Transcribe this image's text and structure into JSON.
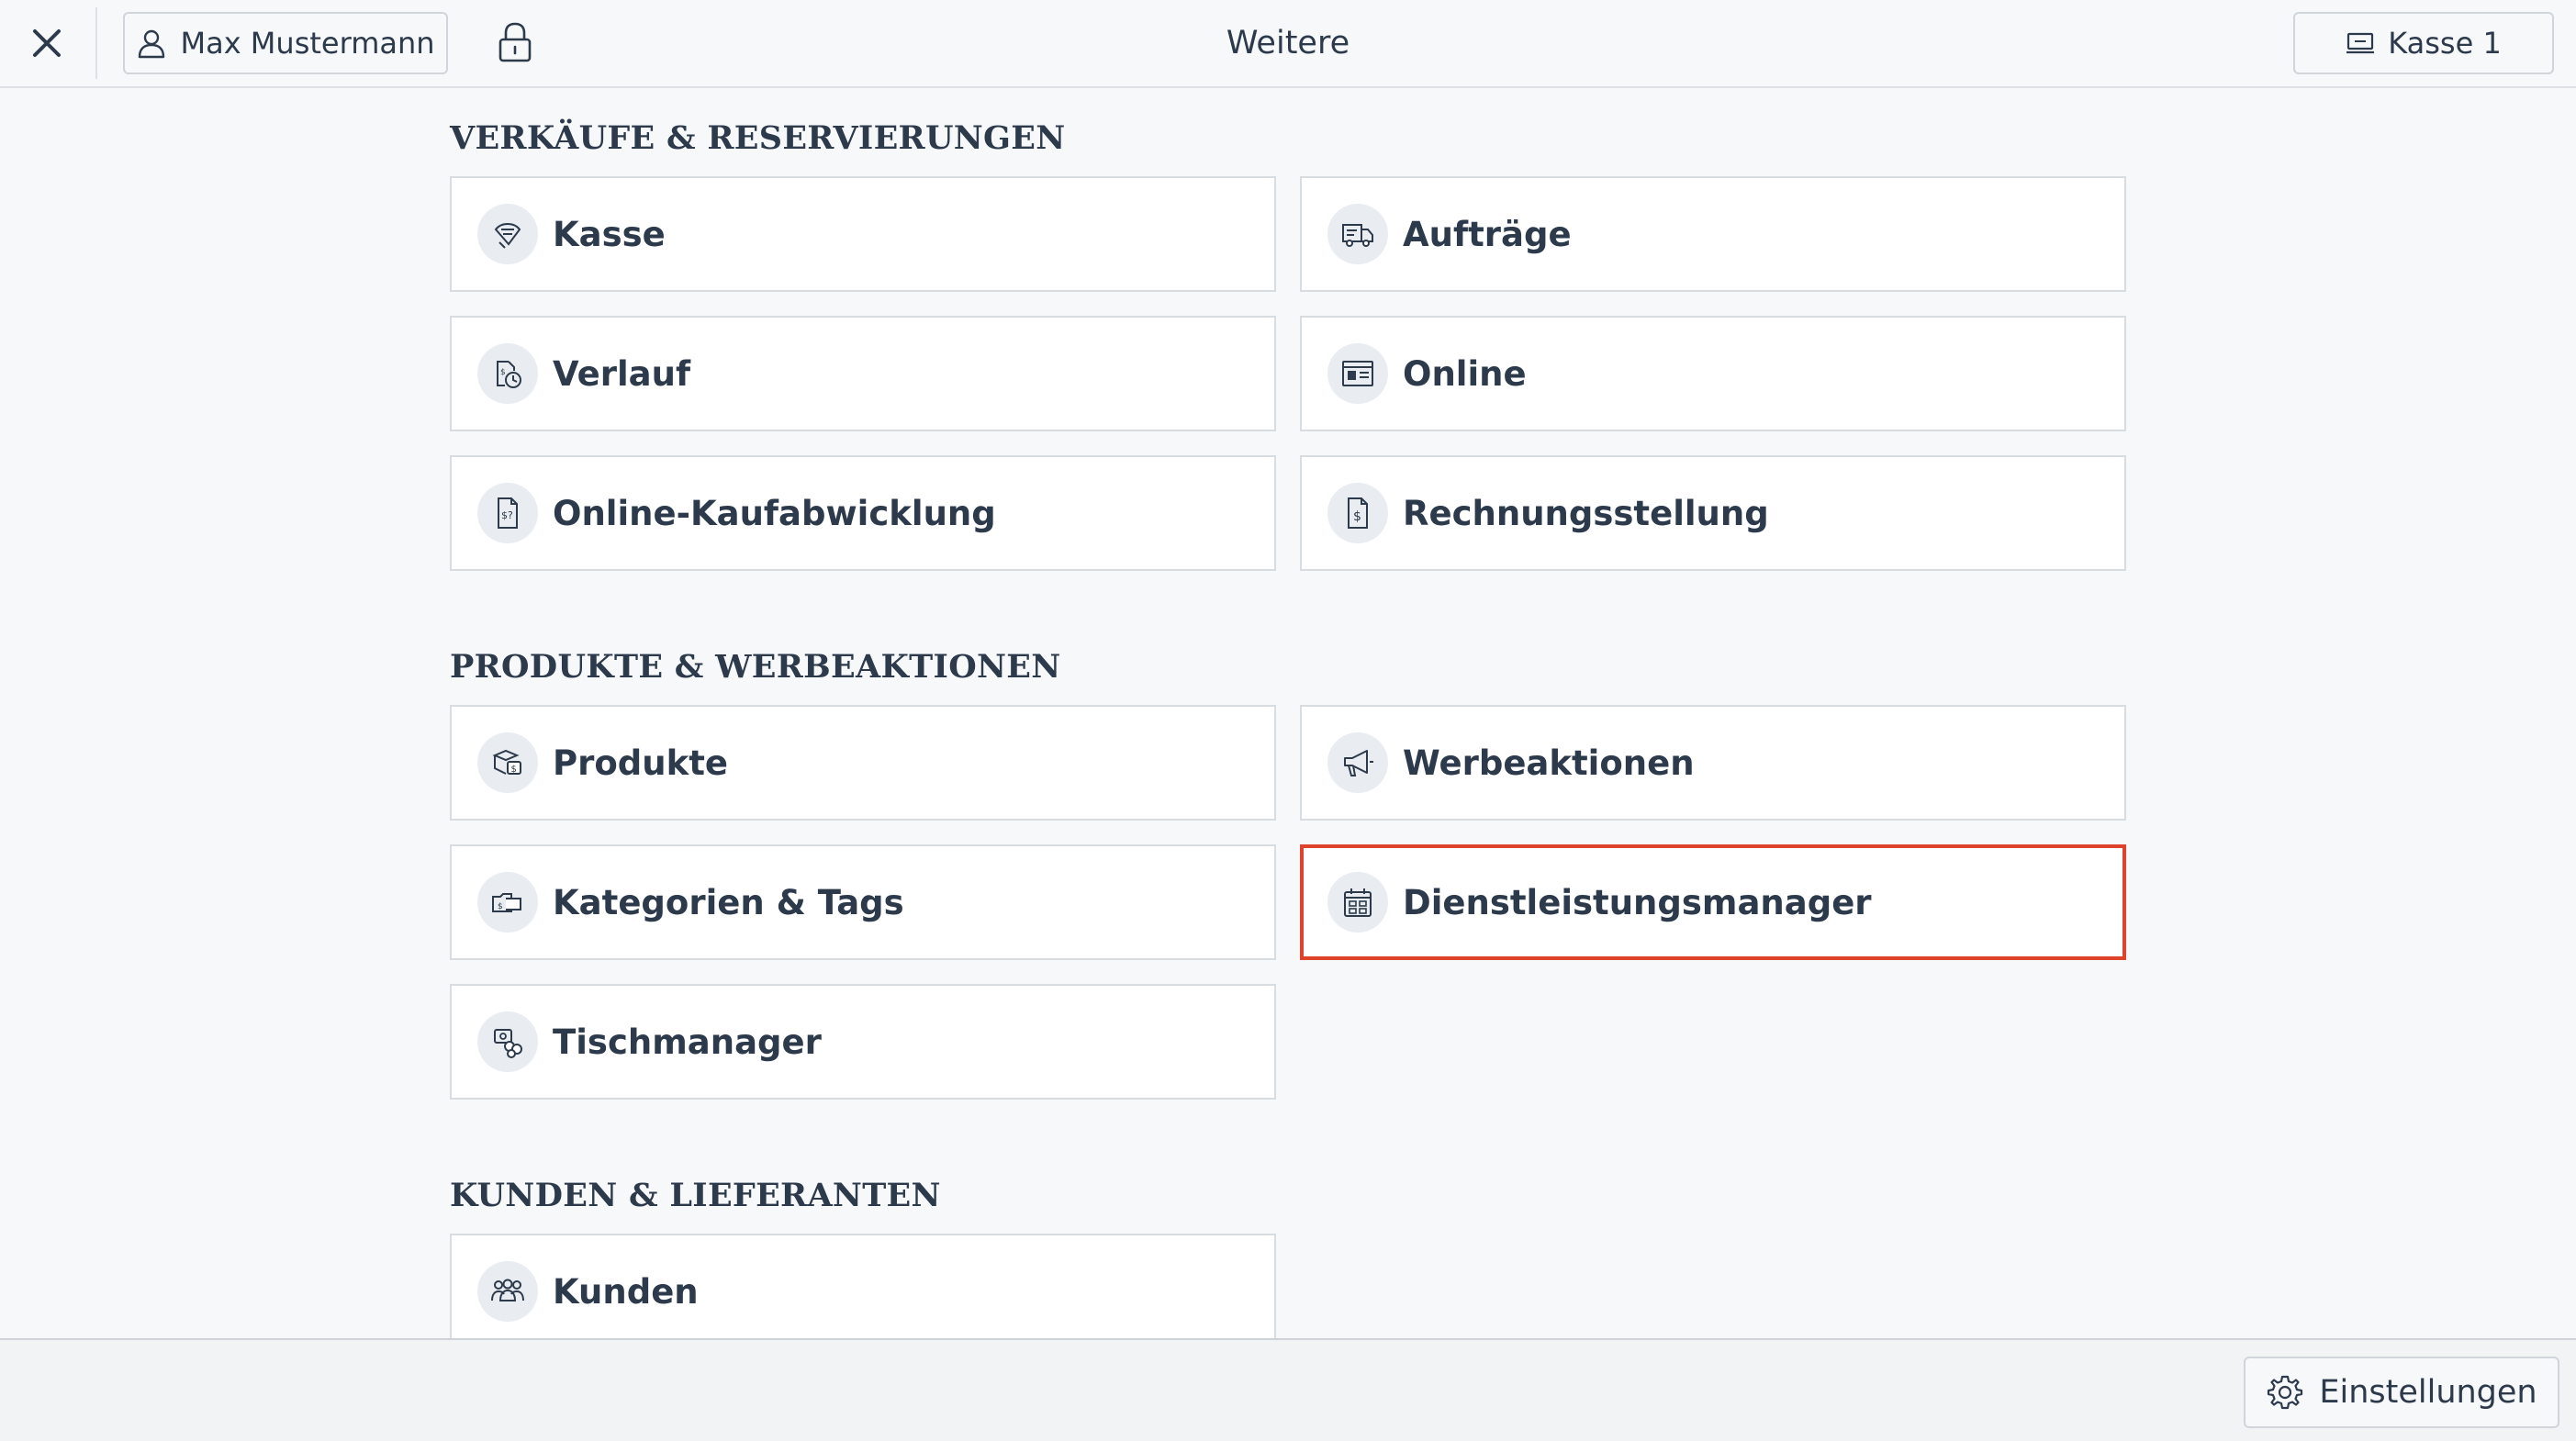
{
  "header": {
    "close_icon": "close-icon",
    "user_name": "Max Mustermann",
    "user_icon": "user-icon",
    "lock_icon": "lock-icon",
    "title": "Weitere",
    "register_label": "Kasse 1",
    "register_icon": "cash-register-icon"
  },
  "sections": [
    {
      "heading": "VERKÄUFE & RESERVIERUNGEN",
      "items": [
        {
          "label": "Kasse",
          "icon": "pos-icon"
        },
        {
          "label": "Aufträge",
          "icon": "orders-icon"
        },
        {
          "label": "Verlauf",
          "icon": "history-icon"
        },
        {
          "label": "Online",
          "icon": "online-store-icon"
        },
        {
          "label": "Online-Kaufabwicklung",
          "icon": "online-checkout-icon"
        },
        {
          "label": "Rechnungsstellung",
          "icon": "invoice-icon"
        }
      ]
    },
    {
      "heading": "PRODUKTE & WERBEAKTIONEN",
      "items": [
        {
          "label": "Produkte",
          "icon": "products-icon"
        },
        {
          "label": "Werbeaktionen",
          "icon": "megaphone-icon"
        },
        {
          "label": "Kategorien & Tags",
          "icon": "categories-icon"
        },
        {
          "label": "Dienstleistungsmanager",
          "icon": "calendar-icon",
          "highlighted": true
        },
        {
          "label": "Tischmanager",
          "icon": "table-manager-icon"
        }
      ]
    },
    {
      "heading": "KUNDEN & LIEFERANTEN",
      "items": [
        {
          "label": "Kunden",
          "icon": "customers-icon"
        }
      ]
    }
  ],
  "footer": {
    "settings_label": "Einstellungen",
    "settings_icon": "gear-icon"
  },
  "colors": {
    "text": "#2c3a4b",
    "background": "#f7f8f9",
    "tile_background": "#ffffff",
    "tile_border": "#d7dce1",
    "icon_circle": "#e9edf1",
    "highlight": "#e0432c"
  }
}
